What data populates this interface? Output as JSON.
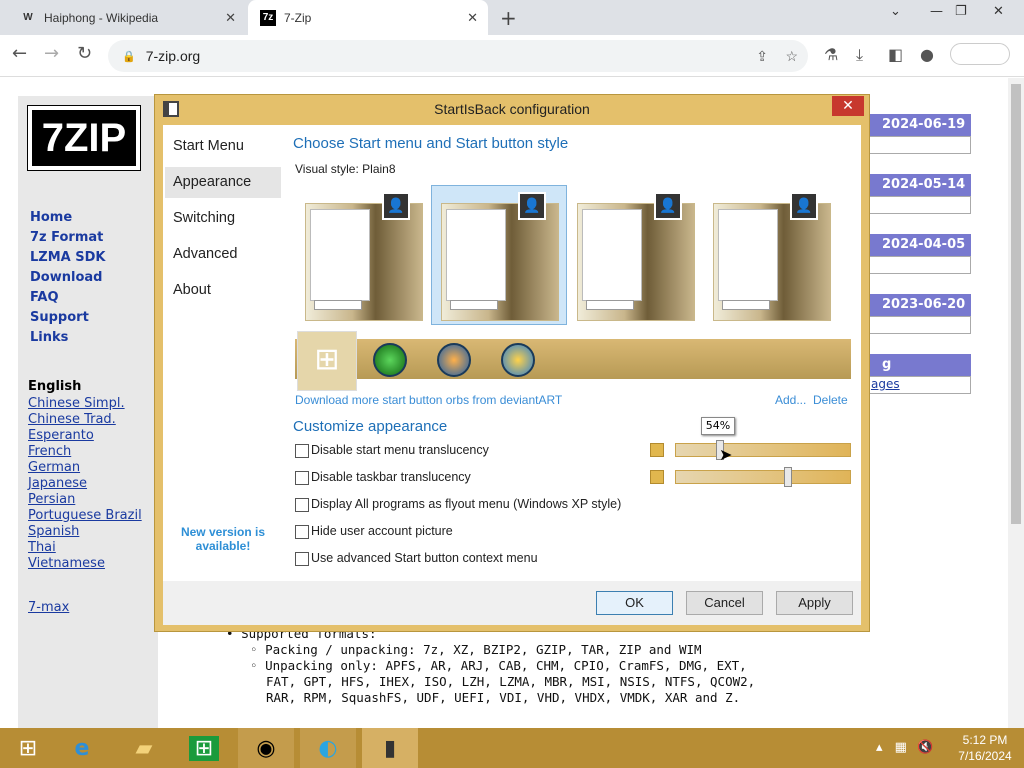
{
  "browser": {
    "tabs": [
      {
        "favicon": "W",
        "title": "Haiphong - Wikipedia"
      },
      {
        "favicon": "7z",
        "title": "7-Zip"
      }
    ],
    "url": "7-zip.org"
  },
  "site": {
    "logo": "7ZIP",
    "nav": [
      "Home",
      "7z Format",
      "LZMA SDK",
      "Download",
      "FAQ",
      "Support",
      "Links"
    ],
    "lang_heading": "English",
    "languages": [
      "Chinese Simpl.",
      "Chinese Trad.",
      "Esperanto",
      "French",
      "German",
      "Japanese",
      "Persian",
      "Portuguese Brazil",
      "Spanish",
      "Thai",
      "Vietnamese"
    ],
    "extra_link": "7-max",
    "news_dates": [
      "2024-06-19",
      "2024-05-14",
      "2024-04-05",
      "2023-06-20"
    ],
    "partial_box_text": "g",
    "partial_box_link": "ages",
    "body_lines": [
      "Supported formats:",
      "Packing / unpacking: 7z, XZ, BZIP2, GZIP, TAR, ZIP and WIM",
      "Unpacking only: APFS, AR, ARJ, CAB, CHM, CPIO, CramFS, DMG, EXT,",
      "FAT, GPT, HFS, IHEX, ISO, LZH, LZMA, MBR, MSI, NSIS, NTFS, QCOW2,",
      "RAR, RPM, SquashFS, UDF, UEFI, VDI, VHD, VHDX, VMDK, XAR and Z."
    ]
  },
  "dialog": {
    "title": "StartIsBack configuration",
    "nav": [
      "Start Menu",
      "Appearance",
      "Switching",
      "Advanced",
      "About"
    ],
    "selected_nav": "Appearance",
    "new_version": "New version is available!",
    "section1_title": "Choose Start menu and Start button style",
    "visual_style_label": "Visual style:",
    "visual_style_value": "Plain8",
    "download_link": "Download more start button orbs from deviantART",
    "add_link": "Add...",
    "delete_link": "Delete",
    "section2_title": "Customize appearance",
    "options": [
      "Disable start menu translucency",
      "Disable taskbar translucency",
      "Display All programs as flyout menu (Windows XP style)",
      "Hide user account picture",
      "Use advanced Start button context menu"
    ],
    "slider1_value": "54%",
    "slider1_level": 0.24,
    "slider2_level": 0.65,
    "buttons": {
      "ok": "OK",
      "cancel": "Cancel",
      "apply": "Apply"
    }
  },
  "taskbar": {
    "time": "5:12 PM",
    "date": "7/16/2024"
  },
  "colors": {
    "dialog_frame": "#e4c06b",
    "taskbar": "#b78d35",
    "accent_blue": "#1e6fb7",
    "news_header": "#7879cf"
  }
}
